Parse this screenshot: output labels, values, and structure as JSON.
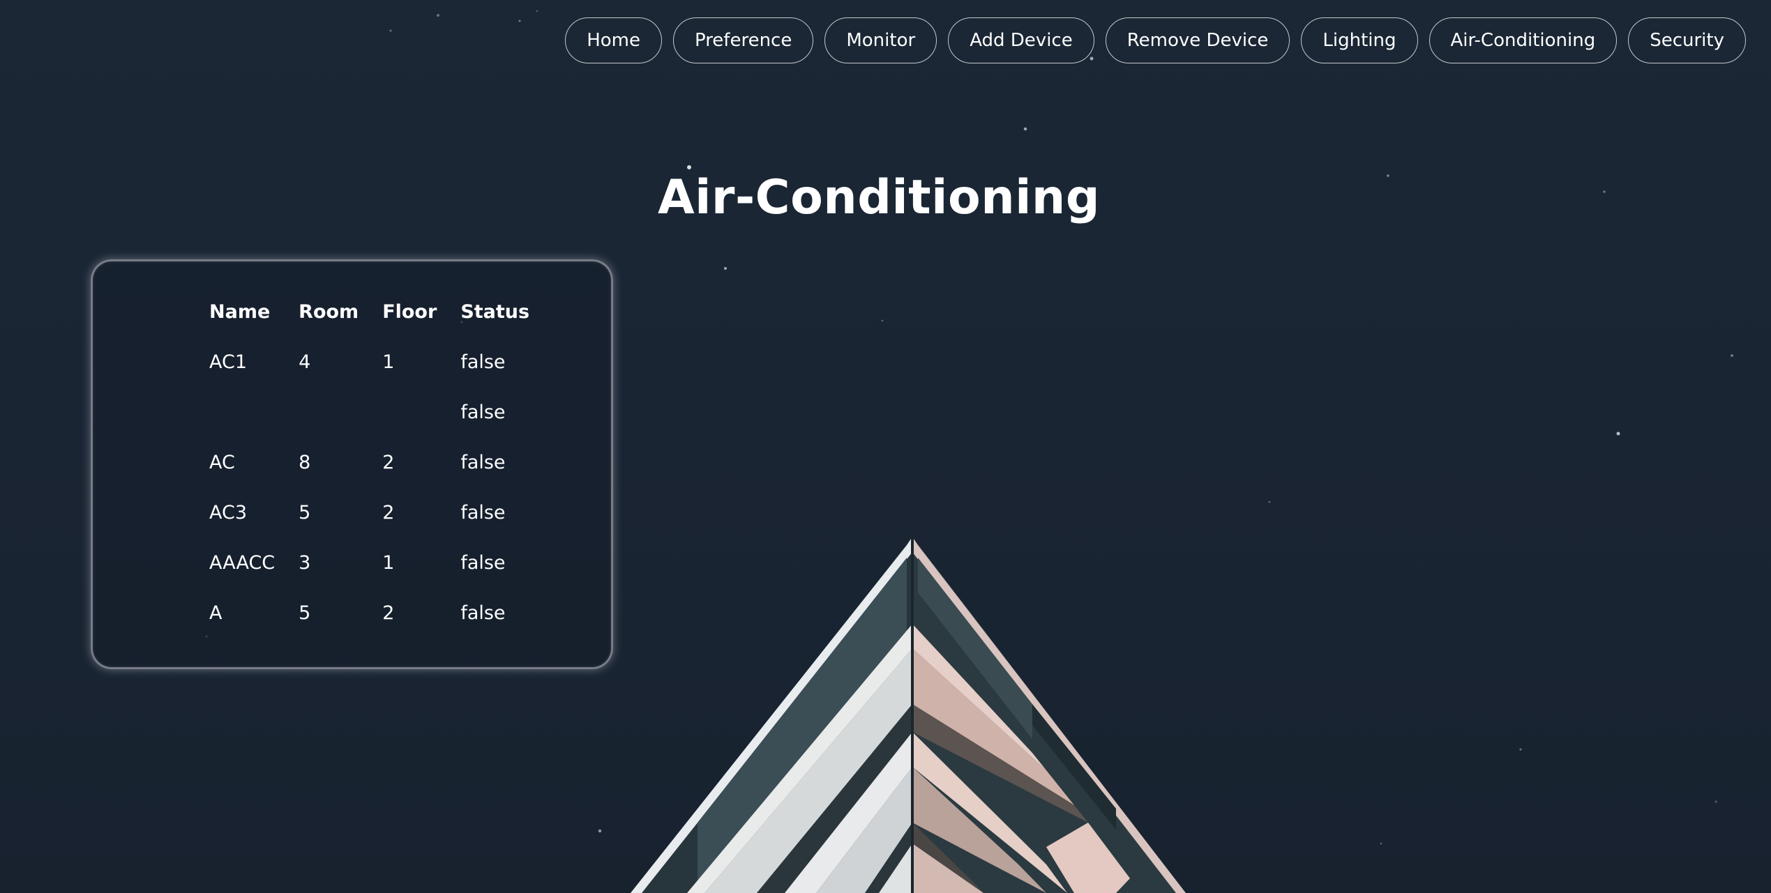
{
  "nav": {
    "items": [
      {
        "label": "Home"
      },
      {
        "label": "Preference"
      },
      {
        "label": "Monitor"
      },
      {
        "label": "Add Device"
      },
      {
        "label": "Remove Device"
      },
      {
        "label": "Lighting"
      },
      {
        "label": "Air-Conditioning"
      },
      {
        "label": "Security"
      }
    ]
  },
  "page": {
    "title": "Air-Conditioning"
  },
  "table": {
    "headers": {
      "name": "Name",
      "room": "Room",
      "floor": "Floor",
      "status": "Status"
    },
    "rows": [
      {
        "name": "AC1",
        "room": "4",
        "floor": "1",
        "status": "false"
      },
      {
        "name": "",
        "room": "",
        "floor": "",
        "status": "false"
      },
      {
        "name": "AC",
        "room": "8",
        "floor": "2",
        "status": "false"
      },
      {
        "name": "AC3",
        "room": "5",
        "floor": "2",
        "status": "false"
      },
      {
        "name": "AAACC",
        "room": "3",
        "floor": "1",
        "status": "false"
      },
      {
        "name": "A",
        "room": "5",
        "floor": "2",
        "status": "false"
      }
    ]
  },
  "colors": {
    "background": "#1a2533",
    "text": "#ffffff"
  }
}
